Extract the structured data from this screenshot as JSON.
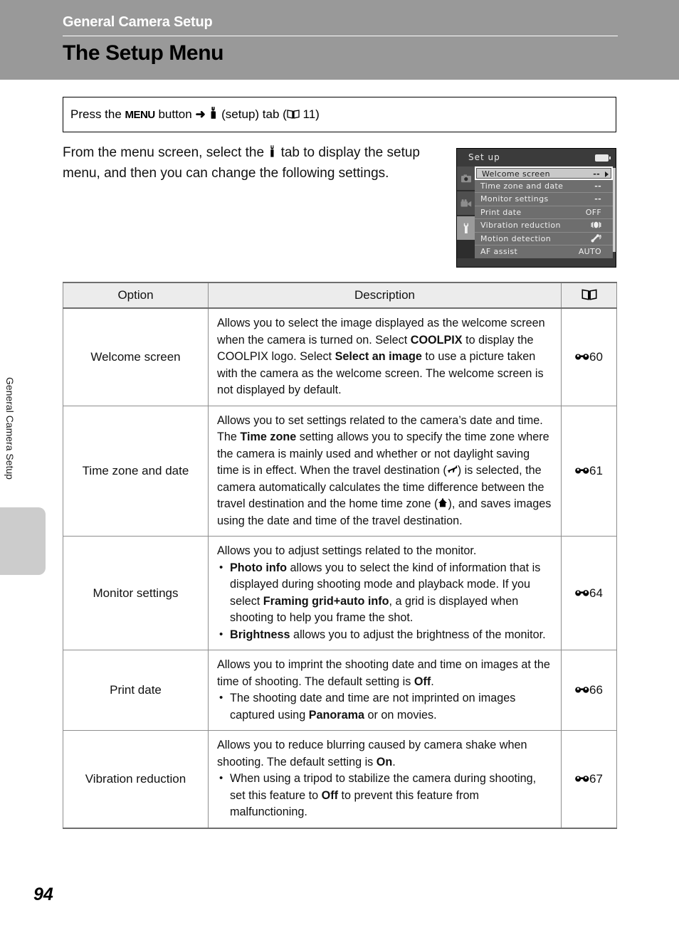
{
  "header": {
    "chapter": "General Camera Setup",
    "title": "The Setup Menu"
  },
  "sidebar": {
    "vertical_label": "General Camera Setup"
  },
  "instruction": {
    "before_menu": "Press the ",
    "menu_label": "MENU",
    "after_menu": " button ",
    "arrow": "➜",
    "after_arrow": " (setup) tab (",
    "page_ref": " 11)"
  },
  "intro": {
    "part1": "From the menu screen, select the ",
    "part2": " tab to display the setup menu, and then you can change the following settings."
  },
  "camera_screen": {
    "title": "Set up",
    "battery_icon": "battery-icon",
    "tabs": [
      {
        "name": "shooting-tab",
        "icon": "camera-icon",
        "selected": false
      },
      {
        "name": "movie-tab",
        "icon": "movie-camera-icon",
        "selected": false
      },
      {
        "name": "setup-tab",
        "icon": "wrench-icon",
        "selected": true
      }
    ],
    "rows": [
      {
        "label": "Welcome screen",
        "value": "--",
        "selected": true,
        "caret": true
      },
      {
        "label": "Time zone and date",
        "value": "--",
        "selected": false,
        "caret": false
      },
      {
        "label": "Monitor settings",
        "value": "--",
        "selected": false,
        "caret": false
      },
      {
        "label": "Print date",
        "value": "OFF",
        "selected": false,
        "caret": false
      },
      {
        "label": "Vibration reduction",
        "value": "vibration-icon",
        "selected": false,
        "caret": false
      },
      {
        "label": "Motion detection",
        "value": "motion-icon",
        "selected": false,
        "caret": false
      },
      {
        "label": "AF assist",
        "value": "AUTO",
        "selected": false,
        "caret": false
      }
    ]
  },
  "table": {
    "headers": {
      "option": "Option",
      "description": "Description",
      "reference": "book-icon"
    },
    "rows": [
      {
        "option": "Welcome screen",
        "ref": "60",
        "description_html": "Allows you to select the image displayed as the welcome screen when the camera is turned on. Select <span class=\"b\">COOLPIX</span> to display the COOLPIX logo. Select <span class=\"b\">Select an image</span> to use a picture taken with the camera as the welcome screen. The welcome screen is not displayed by default."
      },
      {
        "option": "Time zone and date",
        "ref": "61",
        "description_html": "Allows you to set settings related to the camera’s date and time. The <span class=\"b\">Time zone</span> setting allows you to specify the time zone where the camera is mainly used and whether or not daylight saving time is in effect. When the travel destination (<svg class=\"ico ico-plane\" viewBox=\"0 0 16 14\"><path d=\"M1.5 8.2 L13 3.2 L13.6 1.2 L15 0.8 L14.8 3.0 L15.4 4.4 L11.6 6.1 L10.4 11.0 L8.9 11.6 L8.7 7.2 L4.4 9.2 L4.0 11.4 L2.6 11.9 L2.2 9.6 L0.9 9.0 Z\" fill=\"#000\"/></svg>) is selected, the camera automatically calculates the time difference between the travel destination and the home time zone (<svg class=\"ico ico-home\" viewBox=\"0 0 14 14\"><path d=\"M7 1 L13 7 L11 7 L11 12.5 L3 12.5 L3 7 L1 7 Z\" fill=\"#000\"/><rect x=\"6\" y=\"0.5\" width=\"2\" height=\"2.5\" fill=\"#000\"/></svg>), and saves images using the date and time of the travel destination."
      },
      {
        "option": "Monitor settings",
        "ref": "64",
        "description_html": "Allows you to adjust settings related to the monitor.<ul><li><span class=\"b\">Photo info</span> allows you to select the kind of information that is displayed during shooting mode and playback mode. If you select <span class=\"b\">Framing grid+auto info</span>, a grid is displayed when shooting to help you frame the shot.</li><li><span class=\"b\">Brightness</span> allows you to adjust the brightness of the monitor.</li></ul>"
      },
      {
        "option": "Print date",
        "ref": "66",
        "description_html": "Allows you to imprint the shooting date and time on images at the time of shooting. The default setting is <span class=\"b\">Off</span>.<ul><li>The shooting date and time are not imprinted on images captured using <span class=\"b\">Panorama</span> or on movies.</li></ul>"
      },
      {
        "option": "Vibration reduction",
        "ref": "67",
        "description_html": "Allows you to reduce blurring caused by camera shake when shooting. The default setting is <span class=\"b\">On</span>.<ul><li>When using a tripod to stabilize the camera during shooting, set this feature to <span class=\"b\">Off</span> to prevent this feature from malfunctioning.</li></ul>"
      }
    ]
  },
  "page_number": "94",
  "colors": {
    "header_band": "#999999",
    "table_header_bg": "#ececec",
    "table_border": "#8e8e8e",
    "side_tab": "#cccccc"
  }
}
